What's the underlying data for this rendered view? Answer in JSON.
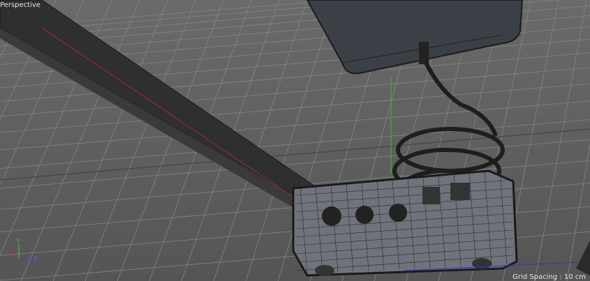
{
  "viewport": {
    "view_name": "Perspective",
    "grid_spacing": "Grid Spacing : 10 cm",
    "axes": {
      "x": "X",
      "y": "Y",
      "z": "Z"
    },
    "colors": {
      "background": "#5e5e5e",
      "grid": "#8a8a8a",
      "x_axis": "#c83030",
      "y_axis": "#30c030",
      "z_axis": "#3030d0"
    }
  }
}
